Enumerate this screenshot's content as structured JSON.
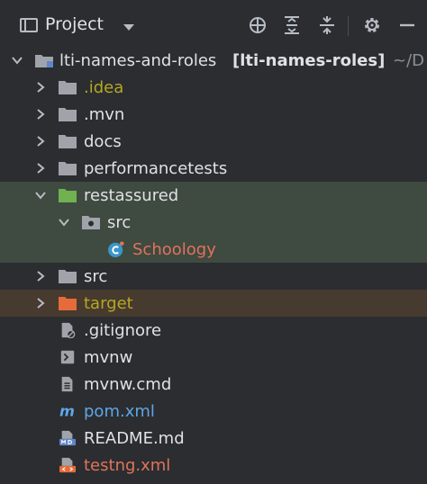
{
  "toolbar": {
    "title": "Project",
    "icons": [
      "view-mode-icon",
      "locate-icon",
      "expand-all-icon",
      "collapse-all-icon",
      "gear-icon",
      "minimize-icon"
    ]
  },
  "tree": {
    "root_name": "lti-names-and-roles",
    "root_module": "[lti-names-roles]",
    "root_path": "~/D",
    "items": [
      {
        "label": ".idea"
      },
      {
        "label": ".mvn"
      },
      {
        "label": "docs"
      },
      {
        "label": "performancetests"
      },
      {
        "label": "restassured"
      },
      {
        "label": "src"
      },
      {
        "label": "Schoology"
      },
      {
        "label": "src"
      },
      {
        "label": "target"
      },
      {
        "label": ".gitignore"
      },
      {
        "label": "mvnw"
      },
      {
        "label": "mvnw.cmd"
      },
      {
        "label": "pom.xml"
      },
      {
        "label": "README.md"
      },
      {
        "label": "testng.xml"
      }
    ]
  },
  "colors": {
    "background": "#2b2d30",
    "selected_row": "#3f4a40",
    "excluded_row": "#473a2e",
    "folder": "#a0a4aa",
    "module_folder": "#6fb24f",
    "excluded_folder": "#e56b3a"
  }
}
